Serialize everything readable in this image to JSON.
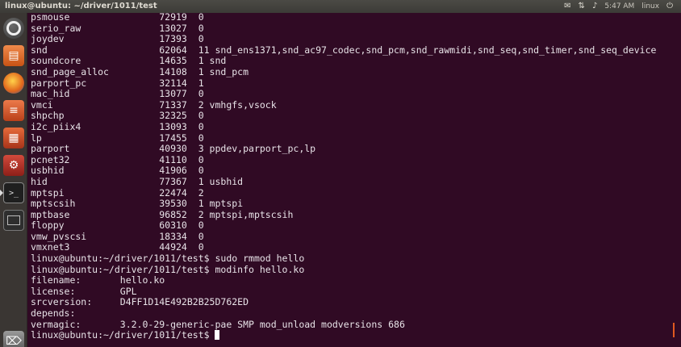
{
  "window": {
    "title": "linux@ubuntu: ~/driver/1011/test"
  },
  "tray": {
    "mail": "✉",
    "network": "⇅",
    "sound": "♪",
    "time": "5:47 AM",
    "user": "linux",
    "power": "⏻"
  },
  "launcher": {
    "items": [
      {
        "name": "dash-home",
        "glyph": ""
      },
      {
        "name": "files",
        "glyph": "▤"
      },
      {
        "name": "firefox",
        "glyph": ""
      },
      {
        "name": "writer",
        "glyph": "≡"
      },
      {
        "name": "calc",
        "glyph": "▦"
      },
      {
        "name": "system-settings",
        "glyph": "⚙"
      },
      {
        "name": "terminal",
        "glyph": ">_"
      },
      {
        "name": "workspace-switcher",
        "glyph": ""
      },
      {
        "name": "trash",
        "glyph": "⌦"
      }
    ]
  },
  "terminal": {
    "lines": [
      "psmouse                72919  0",
      "serio_raw              13027  0",
      "joydev                 17393  0",
      "snd                    62064  11 snd_ens1371,snd_ac97_codec,snd_pcm,snd_rawmidi,snd_seq,snd_timer,snd_seq_device",
      "soundcore              14635  1 snd",
      "snd_page_alloc         14108  1 snd_pcm",
      "parport_pc             32114  1",
      "mac_hid                13077  0",
      "vmci                   71337  2 vmhgfs,vsock",
      "shpchp                 32325  0",
      "i2c_piix4              13093  0",
      "lp                     17455  0",
      "parport                40930  3 ppdev,parport_pc,lp",
      "pcnet32                41110  0",
      "usbhid                 41906  0",
      "hid                    77367  1 usbhid",
      "mptspi                 22474  2",
      "mptscsih               39530  1 mptspi",
      "mptbase                96852  2 mptspi,mptscsih",
      "floppy                 60310  0",
      "vmw_pvscsi             18334  0",
      "vmxnet3                44924  0",
      "linux@ubuntu:~/driver/1011/test$ sudo rmmod hello",
      "linux@ubuntu:~/driver/1011/test$ modinfo hello.ko",
      "filename:       hello.ko",
      "license:        GPL",
      "srcversion:     D4FF1D14E492B2B25D762ED",
      "depends:        ",
      "vermagic:       3.2.0-29-generic-pae SMP mod_unload modversions 686"
    ],
    "prompt": "linux@ubuntu:~/driver/1011/test$ "
  }
}
